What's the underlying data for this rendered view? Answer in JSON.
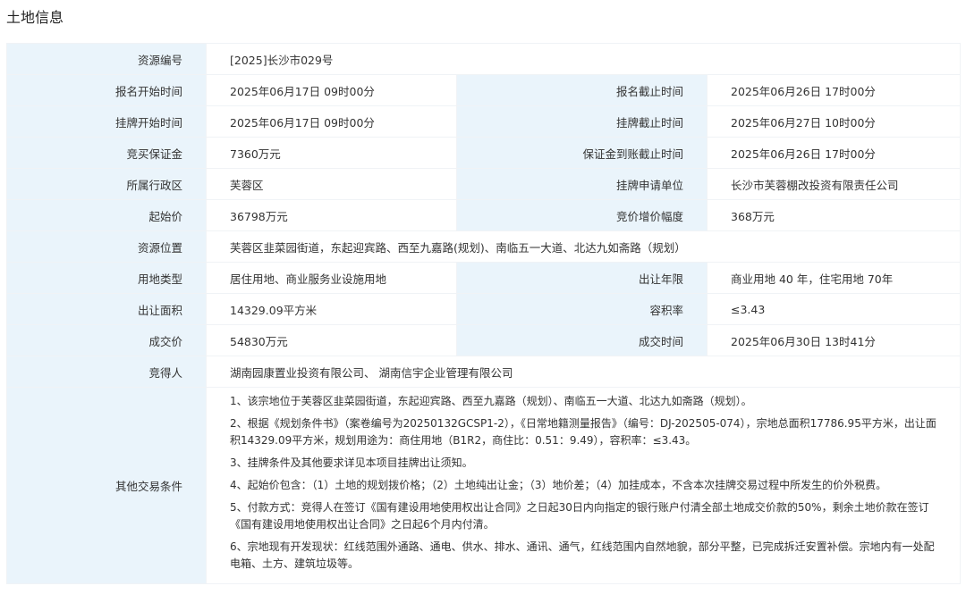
{
  "page_title": "土地信息",
  "rows": [
    {
      "l1": "资源编号",
      "v1": "[2025]长沙市029号"
    },
    {
      "l1": "报名开始时间",
      "v1": "2025年06月17日 09时00分",
      "l2": "报名截止时间",
      "v2": "2025年06月26日 17时00分"
    },
    {
      "l1": "挂牌开始时间",
      "v1": "2025年06月17日 09时00分",
      "l2": "挂牌截止时间",
      "v2": "2025年06月27日 10时00分"
    },
    {
      "l1": "竞买保证金",
      "v1": "7360万元",
      "l2": "保证金到账截止时间",
      "v2": "2025年06月26日 17时00分"
    },
    {
      "l1": "所属行政区",
      "v1": "芙蓉区",
      "l2": "挂牌申请单位",
      "v2": "长沙市芙蓉棚改投资有限责任公司"
    },
    {
      "l1": "起始价",
      "v1": "36798万元",
      "l2": "竞价增价幅度",
      "v2": "368万元"
    },
    {
      "l1": "资源位置",
      "v1": "芙蓉区韭菜园街道，东起迎宾路、西至九嘉路(规划)、南临五一大道、北达九如斋路（规划）"
    },
    {
      "l1": "用地类型",
      "v1": "居住用地、商业服务业设施用地",
      "l2": "出让年限",
      "v2": "商业用地 40 年，住宅用地 70年"
    },
    {
      "l1": "出让面积",
      "v1": "14329.09平方米",
      "l2": "容积率",
      "v2": "≤3.43"
    },
    {
      "l1": "成交价",
      "v1": "54830万元",
      "l2": "成交时间",
      "v2": "2025年06月30日 13时41分"
    },
    {
      "l1": "竞得人",
      "v1": "湖南园康置业投资有限公司、 湖南信宇企业管理有限公司"
    }
  ],
  "other_conditions": {
    "label": "其他交易条件",
    "items": [
      "1、该宗地位于芙蓉区韭菜园街道，东起迎宾路、西至九嘉路（规划）、南临五一大道、北达九如斋路（规划）。",
      "2、根据《规划条件书》（案卷编号为20250132GCSP1-2），《日常地籍测量报告》（编号：DJ-202505-074），宗地总面积17786.95平方米，出让面积14329.09平方米，规划用途为：商住用地（B1R2，商住比：0.51：9.49），容积率：≤3.43。",
      "3、挂牌条件及其他要求详见本项目挂牌出让须知。",
      "4、起始价包含：（1）土地的规划拨价格；（2）土地纯出让金；（3）地价差；（4）加挂成本，不含本次挂牌交易过程中所发生的价外税费。",
      "5、付款方式：竞得人在签订《国有建设用地使用权出让合同》之日起30日内向指定的银行账户付清全部土地成交价款的50%，剩余土地价款在签订《国有建设用地使用权出让合同》之日起6个月内付清。",
      "6、宗地现有开发现状：红线范围外通路、通电、供水、排水、通讯、通气，红线范围内自然地貌，部分平整，已完成拆迁安置补偿。宗地内有一处配电箱、土方、建筑垃圾等。"
    ]
  },
  "colors": {
    "label_bg": "#eaf4fb",
    "border": "#f0f3f6",
    "text": "#333333"
  }
}
